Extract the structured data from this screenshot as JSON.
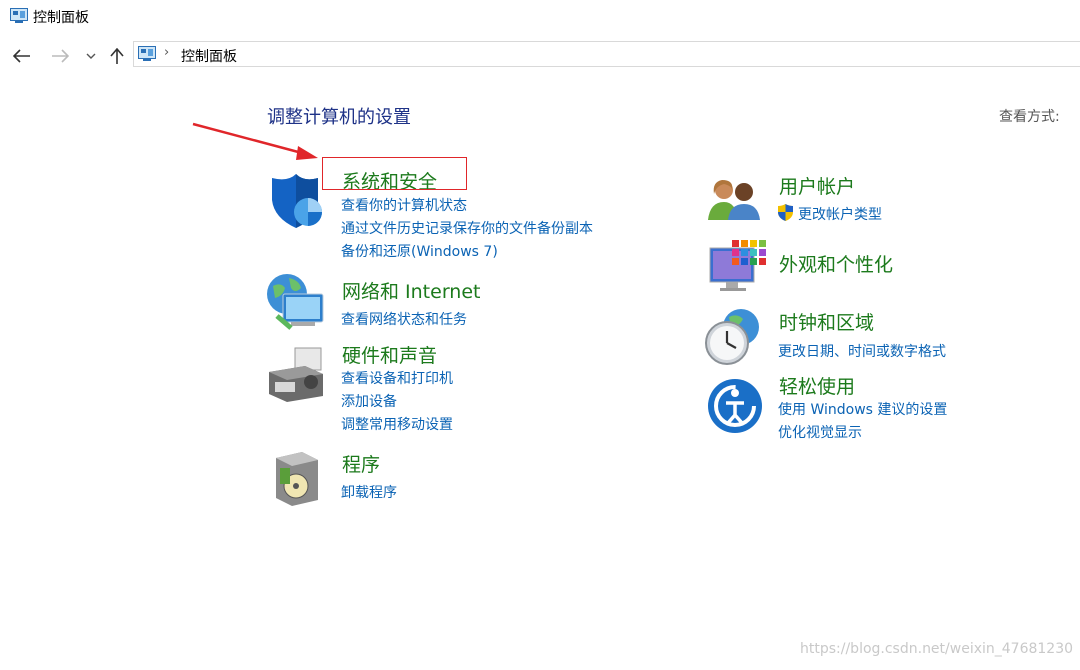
{
  "window": {
    "title": "控制面板"
  },
  "address_bar": {
    "path": "控制面板"
  },
  "main": {
    "heading": "调整计算机的设置",
    "view_by_label": "查看方式:"
  },
  "categories": {
    "system_security": {
      "title": "系统和安全",
      "links": [
        "查看你的计算机状态",
        "通过文件历史记录保存你的文件备份副本",
        "备份和还原(Windows 7)"
      ]
    },
    "network": {
      "title": "网络和 Internet",
      "links": [
        "查看网络状态和任务"
      ]
    },
    "hardware": {
      "title": "硬件和声音",
      "links": [
        "查看设备和打印机",
        "添加设备",
        "调整常用移动设置"
      ]
    },
    "programs": {
      "title": "程序",
      "links": [
        "卸载程序"
      ]
    },
    "user_accounts": {
      "title": "用户帐户",
      "links": [
        "更改帐户类型"
      ]
    },
    "appearance": {
      "title": "外观和个性化",
      "links": []
    },
    "clock_region": {
      "title": "时钟和区域",
      "links": [
        "更改日期、时间或数字格式"
      ]
    },
    "ease_of_access": {
      "title": "轻松使用",
      "links": [
        "使用 Windows 建议的设置",
        "优化视觉显示"
      ]
    }
  },
  "watermark": "https://blog.csdn.net/weixin_47681230",
  "colors": {
    "category_title": "#1c7a1c",
    "link": "#0b63b4",
    "heading": "#1e3287",
    "highlight": "#e0262a"
  }
}
